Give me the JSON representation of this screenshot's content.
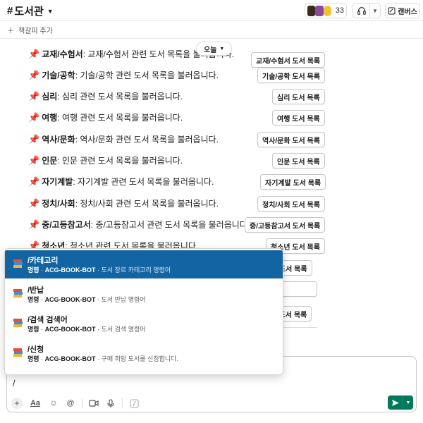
{
  "header": {
    "channel_prefix": "#",
    "channel_name": "도서관",
    "member_count": "33",
    "canvas_label": "캔버스"
  },
  "bookmark": {
    "label": "책갈피 추가"
  },
  "date_pill": {
    "label": "오늘"
  },
  "messages": [
    {
      "category": "교재/수험서",
      "desc": ": 교재/수험서 관련 도서 목록을 불러옵니다.",
      "button": "교재/수험서 도서 목록"
    },
    {
      "category": "기술/공학",
      "desc": ": 기술/공학 관련 도서 목록을 불러옵니다.",
      "button": "기술/공학 도서 목록"
    },
    {
      "category": "심리",
      "desc": ": 심리 관련 도서 목록을 불러옵니다.",
      "button": "심리 도서 목록"
    },
    {
      "category": "여행",
      "desc": ": 여행 관련 도서 목록을 불러옵니다.",
      "button": "여행 도서 목록"
    },
    {
      "category": "역사/문화",
      "desc": ": 역사/문화 관련 도서 목록을 불러옵니다.",
      "button": "역사/문화 도서 목록"
    },
    {
      "category": "인문",
      "desc": ": 인문 관련 도서 목록을 불러옵니다.",
      "button": "인문 도서 목록"
    },
    {
      "category": "자기계발",
      "desc": ": 자기계발 관련 도서 목록을 불러옵니다.",
      "button": "자기계발 도서 목록"
    },
    {
      "category": "정치/사회",
      "desc": ": 정치/사회 관련 도서 목록을 불러옵니다.",
      "button": "정치/사회 도서 목록"
    },
    {
      "category": "중/고등참고서",
      "desc": ": 중/고등참고서 관련 도서 목록을 불러옵니다.",
      "button": "중/고등참고서 도서 목록"
    },
    {
      "category": "청소년",
      "desc": ": 청소년 관련 도서 목록을 불러옵니다.",
      "button": "청소년 도서 목록"
    },
    {
      "category": "",
      "desc": "",
      "button": "츠 도서 목록"
    },
    {
      "category": "",
      "desc": "",
      "button": ""
    },
    {
      "category": "",
      "desc": "",
      "button": "IT 도서 목록"
    }
  ],
  "command_popup": {
    "items": [
      {
        "name": "/카테고리",
        "type": "명령",
        "app": "ACG-BOOK-BOT",
        "desc": "· 도서 장르 카테고리 명령어",
        "selected": true
      },
      {
        "name": "/반납",
        "type": "명령",
        "app": "ACG-BOOK-BOT",
        "desc": "· 도서 반납 명령어",
        "selected": false
      },
      {
        "name": "/검색 검색어",
        "type": "명령",
        "app": "ACG-BOOK-BOT",
        "desc": "· 도서 검색 명령어",
        "selected": false
      },
      {
        "name": "/신청",
        "type": "명령",
        "app": "ACG-BOOK-BOT",
        "desc": "· 구매 희망 도서를 신청합니다.",
        "selected": false
      }
    ]
  },
  "composer": {
    "value": "/"
  },
  "colors": {
    "accent": "#1264a3",
    "send": "#007a5a",
    "pin": "#d6283a"
  }
}
